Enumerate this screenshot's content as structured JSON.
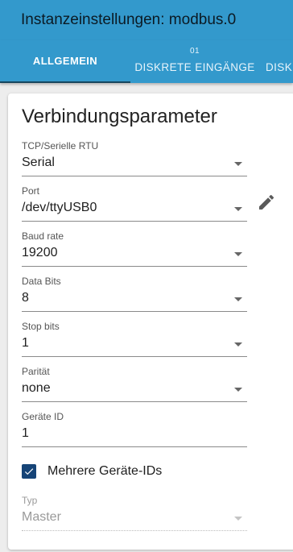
{
  "header": {
    "title": "Instanzeinstellungen: modbus.0"
  },
  "tabs": [
    {
      "label": "ALLGEMEIN",
      "number": ""
    },
    {
      "label": "DISKRETE EINGÄNGE",
      "number": "01"
    },
    {
      "label": "DISKRETE",
      "number": ""
    }
  ],
  "card": {
    "title": "Verbindungsparameter"
  },
  "fields": {
    "connection_type": {
      "label": "TCP/Serielle RTU",
      "value": "Serial"
    },
    "port": {
      "label": "Port",
      "value": "/dev/ttyUSB0"
    },
    "baud_rate": {
      "label": "Baud rate",
      "value": "19200"
    },
    "data_bits": {
      "label": "Data Bits",
      "value": "8"
    },
    "stop_bits": {
      "label": "Stop bits",
      "value": "1"
    },
    "parity": {
      "label": "Parität",
      "value": "none"
    },
    "device_id": {
      "label": "Geräte ID",
      "value": "1"
    },
    "type": {
      "label": "Typ",
      "value": "Master"
    }
  },
  "checkbox": {
    "label": "Mehrere Geräte-IDs",
    "checked": true
  },
  "colors": {
    "header_bg": "#3399cc",
    "accent_dark": "#164477",
    "page_bg": "#ededed"
  },
  "icons": {
    "edit": "pencil-icon",
    "check": "check-icon",
    "dropdown": "caret-down-icon"
  }
}
